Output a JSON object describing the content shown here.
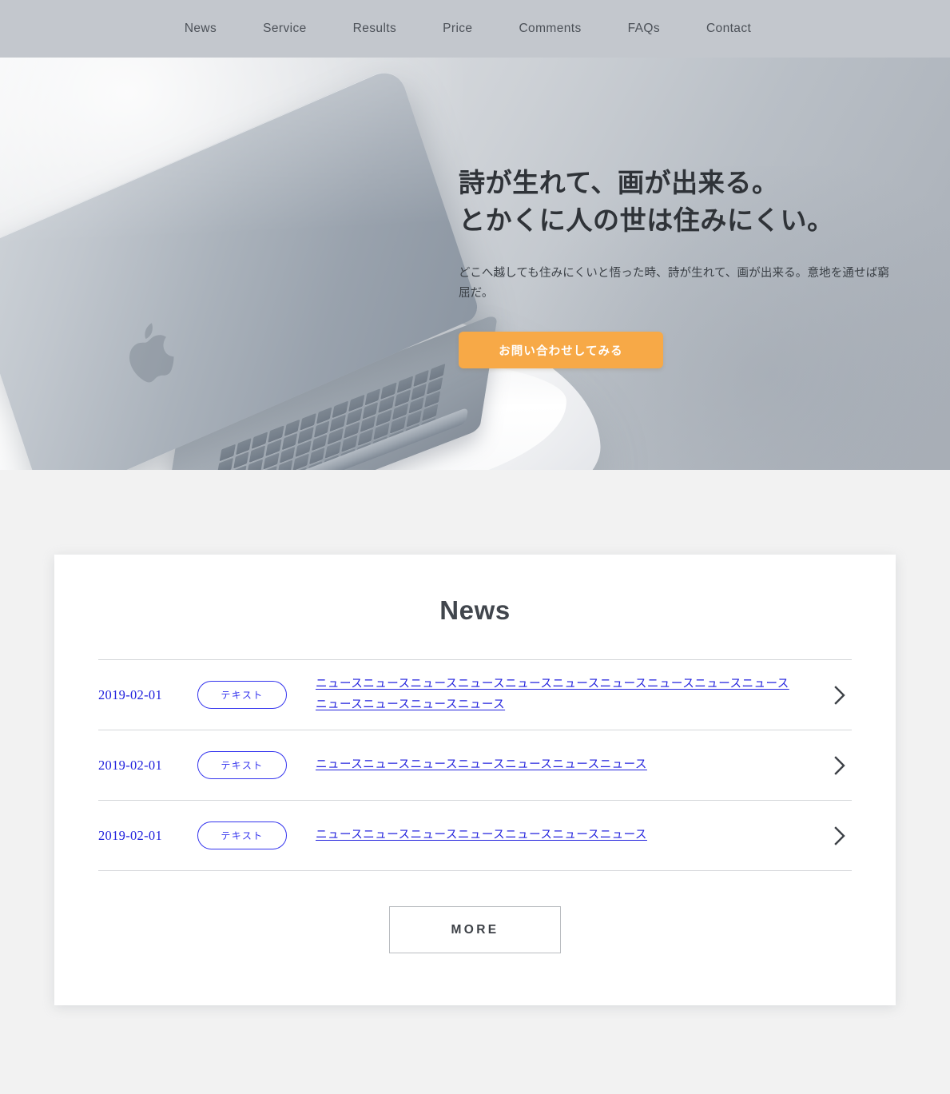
{
  "header": {
    "nav_items": [
      {
        "label": "News"
      },
      {
        "label": "Service"
      },
      {
        "label": "Results"
      },
      {
        "label": "Price"
      },
      {
        "label": "Comments"
      },
      {
        "label": "FAQs"
      },
      {
        "label": "Contact"
      }
    ]
  },
  "hero": {
    "title_line1": "詩が生れて、画が出来る。",
    "title_line2": "とかくに人の世は住みにくい。",
    "subtext": "どこへ越しても住みにくいと悟った時、詩が生れて、画が出来る。意地を通せば窮屈だ。",
    "cta_label": "お問い合わせしてみる",
    "cta_color": "#f7a947",
    "image_alt": "laptop-on-white-chair"
  },
  "news": {
    "heading": "News",
    "rows": [
      {
        "date": "2019-02-01",
        "badge": "テキスト",
        "text": "ニュースニュースニュースニュースニュースニュースニュースニュースニュースニュースニュースニュースニュースニュース",
        "arrow": "chevron-right-icon"
      },
      {
        "date": "2019-02-01",
        "badge": "テキスト",
        "text": "ニュースニュースニュースニュースニュースニュースニュース",
        "arrow": "chevron-right-icon"
      },
      {
        "date": "2019-02-01",
        "badge": "テキスト",
        "text": "ニュースニュースニュースニュースニュースニュースニュース",
        "arrow": "chevron-right-icon"
      }
    ],
    "more_label": "MORE",
    "link_color": "#2222dd"
  },
  "theme": {
    "header_bg": "#c3c7cd",
    "page_bg": "#f2f2f2",
    "card_bg": "#ffffff",
    "text_dark": "#3d4147"
  }
}
